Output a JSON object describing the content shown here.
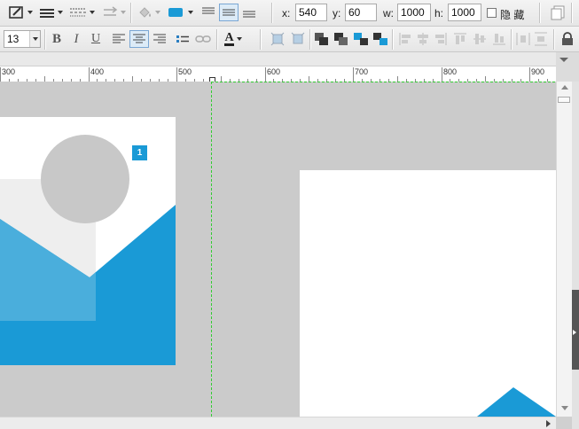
{
  "toolbar_top": {
    "fields": [
      {
        "label": "x:",
        "value": "540"
      },
      {
        "label": "y:",
        "value": "60"
      },
      {
        "label": "w:",
        "value": "1000"
      },
      {
        "label": "h:",
        "value": "1000"
      }
    ],
    "hidden_label": "隐 藏",
    "hidden_checked": false,
    "icons": [
      "edit-style-icon",
      "line-weight-icon",
      "line-pattern-icon",
      "arrow-style-icon",
      "fill-color-icon",
      "shadow-icon",
      "align-top-text-icon",
      "align-middle-text-icon",
      "align-bottom-text-icon",
      "page-copy-icon"
    ]
  },
  "toolbar_text": {
    "font_size": "13",
    "bold": "B",
    "italic": "I",
    "underline": "U",
    "font_color_letter": "A",
    "icons": [
      "align-left-icon",
      "align-center-icon",
      "align-right-icon",
      "bullet-list-icon",
      "link-icon",
      "font-color-icon",
      "fit-width-icon",
      "fit-height-icon",
      "bring-front-icon",
      "bring-forward-icon",
      "send-backward-icon",
      "send-back-icon",
      "lock-icon"
    ]
  },
  "ruler": {
    "labels": [
      "300",
      "400",
      "500",
      "600",
      "700",
      "800",
      "900"
    ]
  },
  "canvas": {
    "badge": "1",
    "colors": {
      "accent": "#1a9ad6",
      "accent_light": "#4aaedc",
      "placeholder_gray": "#c8c8c8",
      "light_gray": "#eeeeee",
      "guide_green": "#33cc33"
    }
  }
}
